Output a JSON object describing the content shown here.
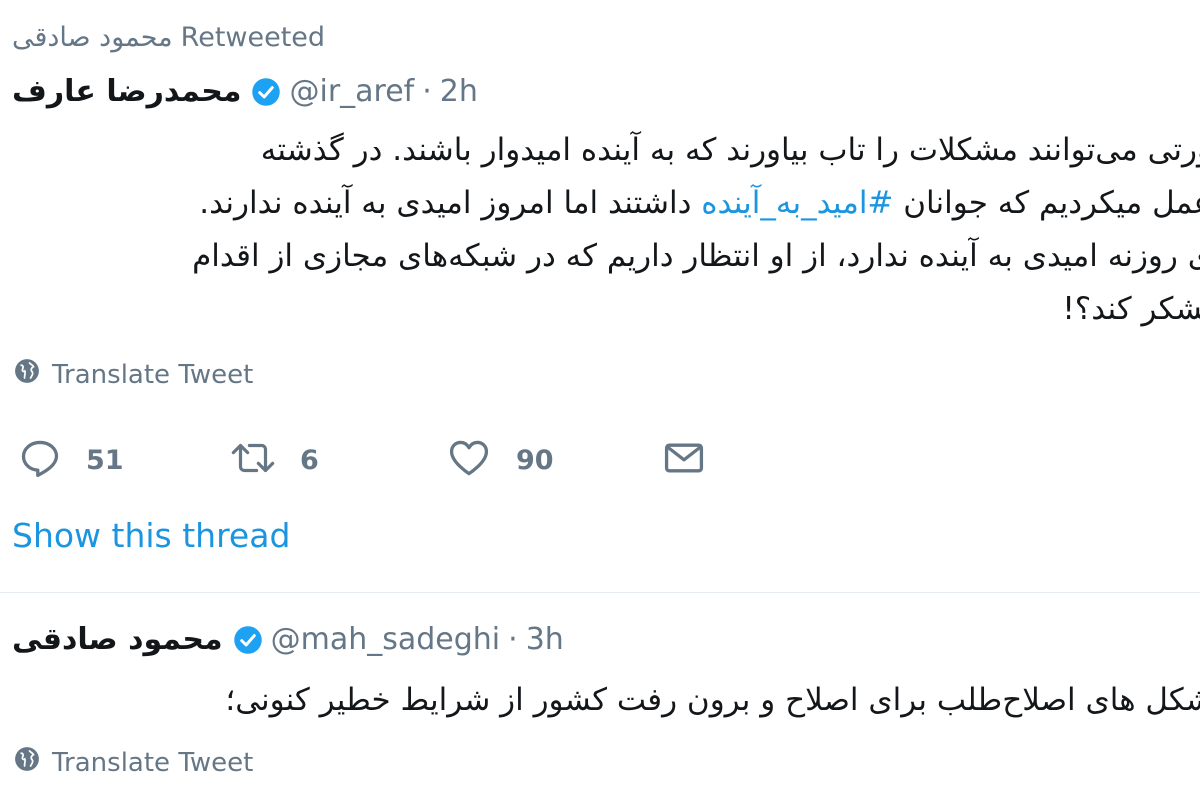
{
  "retweet": {
    "retweeter": "محمود صادقی",
    "label": "Retweeted"
  },
  "tweet1": {
    "name": "محمدرضا عارف",
    "handle": "@ir_aref",
    "separator": "·",
    "time": "2h",
    "lines": [
      "ورتی می‌توانند مشکلات را تاب بیاورند که به آینده امیدوار باشند. در گذشته",
      "عمل میکردیم که جوانان",
      "داشتند اما امروز امیدی به آینده ندارند.",
      "ی روزنه امیدی به آینده ندارد، از او انتظار داریم که در شبکه‌های مجازی از اقدام",
      "تشکر کند؟!"
    ],
    "hashtag": "#امید_به_آینده",
    "translate_label": "Translate Tweet",
    "actions": {
      "reply_count": "51",
      "retweet_count": "6",
      "like_count": "90"
    },
    "show_thread": "Show this thread"
  },
  "tweet2": {
    "name": "محمود صادقی",
    "handle": "@mah_sadeghi",
    "separator": "·",
    "time": "3h",
    "line": "شکل های اصلاح‌طلب برای اصلاح و برون رفت کشور از شرایط خطیر کنونی؛",
    "translate_label": "Translate Tweet"
  },
  "colors": {
    "link": "#1b95e0",
    "muted": "#657786",
    "verified": "#1da1f2",
    "text": "#14171a"
  },
  "icons": [
    "verified-badge-icon",
    "globe-icon",
    "reply-icon",
    "retweet-icon",
    "like-icon",
    "direct-message-icon"
  ]
}
